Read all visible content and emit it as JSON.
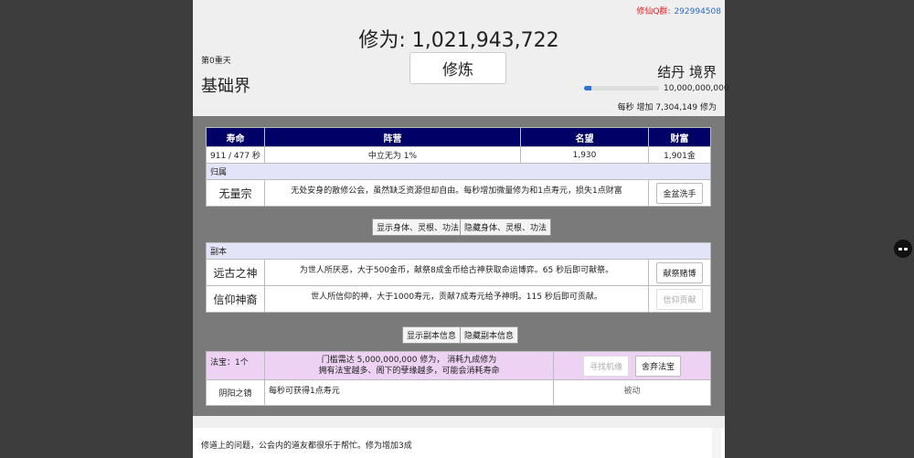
{
  "header": {
    "qq_label": "修仙Q群:",
    "qq_number": "292994508",
    "cultivation_title": "修为: 1,021,943,722",
    "cultivate_button": "修炼",
    "realm_level": "第0重天",
    "realm_name": "基础界",
    "stage": "结丹 境界",
    "progress_text": "10,000,000,000",
    "progress_fraction": 0.102,
    "rate_text": "每秒 增加 7,304,149 修为"
  },
  "stats": {
    "columns": [
      "寿命",
      "阵营",
      "名望",
      "财富"
    ],
    "values": [
      "911 / 477 秒",
      "中立无为 1%",
      "1,930",
      "1,901金"
    ]
  },
  "affiliation": {
    "label": "归属",
    "name": "无量宗",
    "description": "无处安身的散修公会，虽然缺乏资源但却自由。每秒增加微量修为和1点寿元，损失1点财富",
    "button": "金盆洗手"
  },
  "body_buttons": {
    "show": "显示身体、灵根、功法",
    "hide": "隐藏身体、灵根、功法"
  },
  "dungeon": {
    "label": "副本",
    "rows": [
      {
        "name": "远古之神",
        "description": "为世人所厌恶，大于500金币，献祭8成金币给古神获取命运博弈。65 秒后即可献祭。",
        "button": "献祭赌博"
      },
      {
        "name": "信仰神裔",
        "description": "世人所信仰的神，大于1000寿元，贡献7成寿元给予神明。115 秒后即可贡献。",
        "button": "信仰贡献"
      }
    ]
  },
  "dungeon_buttons": {
    "show": "显示副本信息",
    "hide": "隐藏副本信息"
  },
  "treasure": {
    "count_label": "法宝：1个",
    "requirement_line1": "门槛需达 5,000,000,000 修为， 消耗九成修为",
    "requirement_line2": "拥有法宝越多、阁下的孽缘越多，可能会消耗寿命",
    "find_button": "寻找机缘",
    "abandon_button": "舍弃法宝",
    "item_name": "阴阳之镜",
    "item_desc": "每秒可获得1点寿元",
    "item_state": "被动"
  },
  "log": {
    "text": "修道上的问题，公会内的道友都很乐于帮忙。修为增加3成"
  },
  "colors": {
    "table_header_bg": "#000066",
    "progress_fill": "#2a74d9",
    "qq_label": "#e02020",
    "treasure_row_bg": "#edd2f4"
  }
}
